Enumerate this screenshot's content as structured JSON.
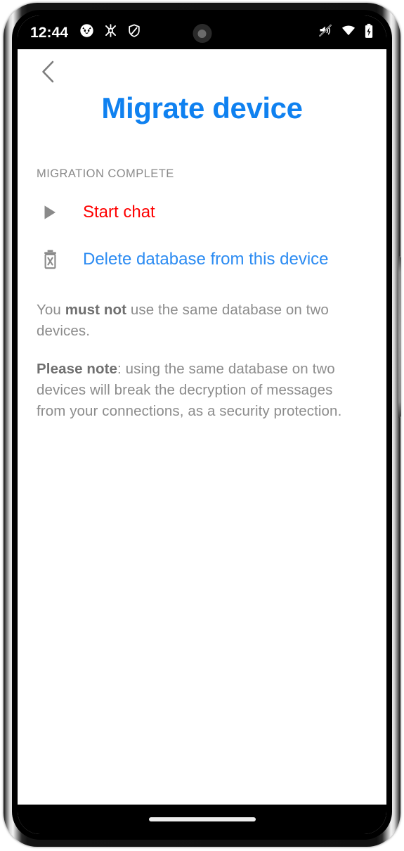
{
  "status_bar": {
    "time": "12:44",
    "left_icons": [
      {
        "name": "cat-face-icon"
      },
      {
        "name": "molecule-icon"
      },
      {
        "name": "shield-icon"
      }
    ],
    "right_icons": [
      {
        "name": "volume-mute-icon"
      },
      {
        "name": "wifi-icon"
      },
      {
        "name": "battery-charging-icon"
      }
    ],
    "camera": "front-camera-punch-hole"
  },
  "app": {
    "back_icon": "chevron-left-icon",
    "title": "Migrate device",
    "section_header": "MIGRATION COMPLETE",
    "actions": [
      {
        "id": "start-chat",
        "icon": "play-triangle-icon",
        "label": "Start chat",
        "color": "#fe0000"
      },
      {
        "id": "delete-database",
        "icon": "trash-delete-icon",
        "label": "Delete database from this device",
        "color": "#2b8bf2"
      }
    ],
    "paragraphs": [
      {
        "id": "warning",
        "lead": "You ",
        "bold": "must not",
        "tail": " use the same database on two devices."
      },
      {
        "id": "note",
        "lead": "",
        "bold": "Please note",
        "tail": ": using the same database on two devices will break the decryption of messages from your connections, as a security protection."
      }
    ]
  },
  "nav_bar": {
    "gesture_pill": "home-gesture-pill"
  },
  "colors": {
    "title_blue": "#0f81f0",
    "link_blue": "#2b8bf2",
    "danger_red": "#fe0000",
    "muted_gray": "#8c8c8c",
    "header_gray": "#8a8a8a",
    "background": "#ffffff",
    "status_bar_bg": "#000000"
  }
}
